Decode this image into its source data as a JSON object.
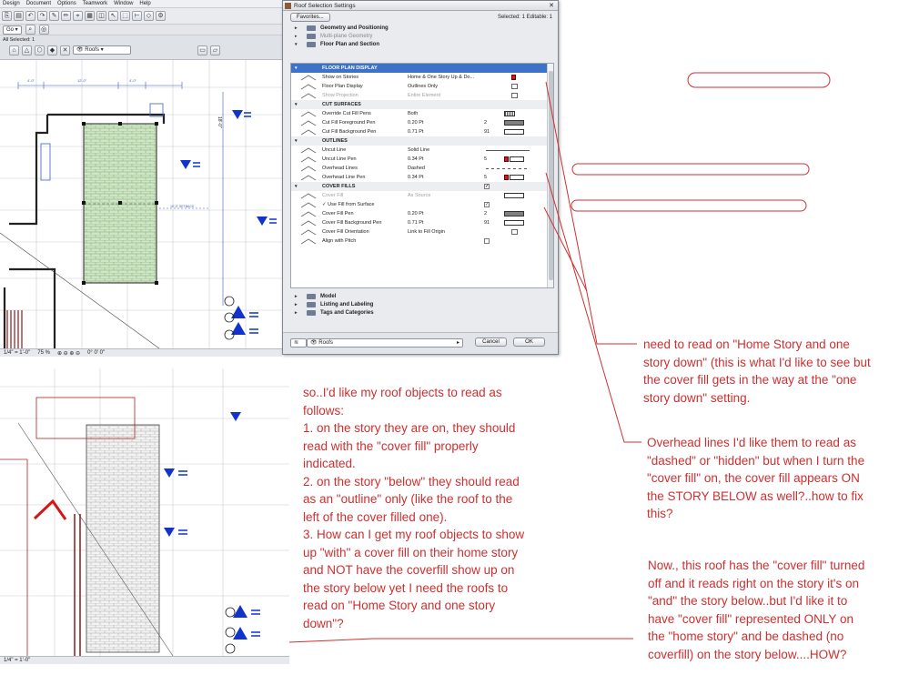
{
  "menubar": [
    "Design",
    "Document",
    "Options",
    "Teamwork",
    "Window",
    "Help"
  ],
  "toolbar": {
    "go_label": "Go",
    "selection_info": "All Selected: 1",
    "element_type": "Roofs"
  },
  "plan_top": {
    "dims": [
      "4'-0\"",
      "12'-0\"",
      "4'-0\"",
      "4'-0\""
    ],
    "vertical_dim": "18'-0\"",
    "setback_label": "10'-0\" SETBACK"
  },
  "status_top": {
    "scale": "1/4\" = 1'-0\"",
    "zoom": "75 %",
    "angle": "0° 0' 0\""
  },
  "status_bottom": {
    "scale": "1/4\" = 1'-0\""
  },
  "dialog": {
    "title": "Roof Selection Settings",
    "favorites": "Favorites...",
    "selected_info": "Selected: 1 Editable: 1",
    "top_sections": [
      {
        "label": "Geometry and Positioning",
        "dim": false,
        "arrow": "▸"
      },
      {
        "label": "Multi-plane Geometry",
        "dim": true,
        "arrow": "▸"
      },
      {
        "label": "Floor Plan and Section",
        "dim": false,
        "arrow": "▾"
      }
    ],
    "panel_rows": [
      {
        "kind": "group",
        "label": "FLOOR PLAN DISPLAY",
        "selected": true
      },
      {
        "kind": "prop",
        "name": "Show on Stories",
        "value": "Home & One Story Up & Do...",
        "widget": "red-icon"
      },
      {
        "kind": "prop",
        "name": "Floor Plan Display",
        "value": "Outlines Only",
        "widget": "icon"
      },
      {
        "kind": "prop",
        "name": "Show Projection",
        "value": "Entire Element",
        "widget": "icon",
        "disabled": true
      },
      {
        "kind": "group",
        "label": "CUT SURFACES"
      },
      {
        "kind": "prop",
        "name": "Override Cut Fill Pens",
        "value": "Both",
        "widget": "pattern"
      },
      {
        "kind": "prop",
        "name": "Cut Fill Foreground Pen",
        "value": "0.20 Pt",
        "num": "2",
        "widget": "swatch-gray"
      },
      {
        "kind": "prop",
        "name": "Cut Fill Background Pen",
        "value": "0.71 Pt",
        "num": "91",
        "widget": "swatch-white"
      },
      {
        "kind": "group",
        "label": "OUTLINES"
      },
      {
        "kind": "prop",
        "name": "Uncut Line",
        "value": "Solid Line",
        "widget": "line-solid"
      },
      {
        "kind": "prop",
        "name": "Uncut Line Pen",
        "value": "0.34 Pt",
        "num": "5",
        "widget": "swatch-red"
      },
      {
        "kind": "prop",
        "name": "Overhead Lines",
        "value": "Dashed",
        "widget": "line-dashed"
      },
      {
        "kind": "prop",
        "name": "Overhead Line Pen",
        "value": "0.34 Pt",
        "num": "5",
        "widget": "swatch-red"
      },
      {
        "kind": "group",
        "label": "COVER FILLS",
        "check": "✓"
      },
      {
        "kind": "prop",
        "name": "Cover Fill",
        "value": "As Source",
        "widget": "swatch-white",
        "disabled": true
      },
      {
        "kind": "prop",
        "name": "✓ Use Fill from Surface",
        "value": "",
        "check": "✓"
      },
      {
        "kind": "prop",
        "name": "Cover Fill Pen",
        "value": "0.20 Pt",
        "num": "2",
        "widget": "swatch-gray"
      },
      {
        "kind": "prop",
        "name": "Cover Fill Background Pen",
        "value": "0.71 Pt",
        "num": "91",
        "widget": "swatch-white"
      },
      {
        "kind": "prop",
        "name": "Cover Fill Orientation",
        "value": "Link to Fill Origin",
        "widget": "icon"
      },
      {
        "kind": "prop",
        "name": "Align with Pitch",
        "value": "",
        "check": ""
      }
    ],
    "bottom_sections": [
      "Model",
      "Listing and Labeling",
      "Tags and Categories"
    ],
    "layer_select": "Roofs",
    "cancel": "Cancel",
    "ok": "OK"
  },
  "notes": {
    "center": [
      "so..I'd like my roof objects to read as",
      "follows:",
      "1. on the story they are on, they should",
      "read with the \"cover fill\" properly",
      "indicated.",
      "2. on the story \"below\" they should read",
      "as an \"outline\" only (like the roof to the",
      "left of the cover filled one).",
      "3. How can I get my roof objects to show",
      "up \"with\" a cover fill on their home story",
      "and NOT have the coverfill show up on",
      "the story below yet I need the roofs to",
      "read on \"Home Story and one story",
      "down\"?"
    ],
    "right1": [
      "need to read on \"Home Story and one",
      "story down\" (this is what I'd like to see but",
      "the cover fill gets in the way at the \"one",
      "story down\" setting."
    ],
    "right2": [
      "Overhead lines I'd like them to read as",
      "\"dashed\" or \"hidden\" but when I turn the",
      "\"cover fill\" on, the cover fill appears ON",
      "the STORY BELOW as well?..how to fix",
      "this?"
    ],
    "right3": [
      "Now., this roof has the \"cover fill\" turned",
      "off and it reads right on the story it's on",
      "\"and\" the story below..but I'd like it to",
      "have \"cover fill\" represented ONLY on",
      "the \"home story\" and be dashed (no",
      "coverfill) on the story below....HOW?"
    ]
  },
  "colors": {
    "annotation": "#cf2f2f",
    "marker_blue": "#1133cc",
    "fill_green": "#cfe6c4",
    "selection": "#3d72c9"
  }
}
